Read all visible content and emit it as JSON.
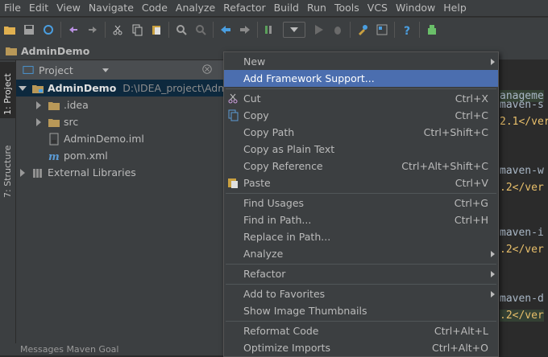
{
  "menubar": [
    "File",
    "Edit",
    "View",
    "Navigate",
    "Code",
    "Analyze",
    "Refactor",
    "Build",
    "Run",
    "Tools",
    "VCS",
    "Window",
    "Help"
  ],
  "navbar": {
    "project": "AdminDemo"
  },
  "side_tabs": {
    "project": "1: Project",
    "structure": "7: Structure"
  },
  "project_panel": {
    "selector": "Project",
    "tree": [
      {
        "label": "AdminDemo",
        "path": "D:\\IDEA_project\\Admin",
        "icon": "module-folder-icon",
        "expanded": true,
        "level": 0,
        "selected": true
      },
      {
        "label": ".idea",
        "icon": "folder-icon",
        "expanded": false,
        "level": 1
      },
      {
        "label": "src",
        "icon": "folder-icon",
        "expanded": false,
        "level": 1
      },
      {
        "label": "AdminDemo.iml",
        "icon": "iml-file-icon",
        "level": 1
      },
      {
        "label": "pom.xml",
        "icon": "maven-file-icon",
        "level": 1
      },
      {
        "label": "External Libraries",
        "icon": "libraries-icon",
        "expanded": false,
        "level": 0
      }
    ]
  },
  "editor_lines": [
    {
      "text": "anageme"
    },
    {
      "text": "maven-s"
    },
    {
      "text": "2.1</ver"
    },
    {
      "text": "maven-w"
    },
    {
      "text": ".2</ver"
    },
    {
      "text": "maven-i"
    },
    {
      "text": ".2</ver"
    },
    {
      "text": "maven-d"
    },
    {
      "text": ".2</ver"
    }
  ],
  "bottom_bar": "Messages Maven Goal",
  "context_menu": [
    {
      "label": "New",
      "submenu": true
    },
    {
      "label": "Add Framework Support...",
      "highlighted": true
    },
    {
      "separator": true
    },
    {
      "label": "Cut",
      "shortcut": "Ctrl+X",
      "icon": "scissors-icon"
    },
    {
      "label": "Copy",
      "shortcut": "Ctrl+C",
      "icon": "copy-icon"
    },
    {
      "label": "Copy Path",
      "shortcut": "Ctrl+Shift+C"
    },
    {
      "label": "Copy as Plain Text"
    },
    {
      "label": "Copy Reference",
      "shortcut": "Ctrl+Alt+Shift+C"
    },
    {
      "label": "Paste",
      "shortcut": "Ctrl+V",
      "icon": "paste-icon"
    },
    {
      "separator": true
    },
    {
      "label": "Find Usages",
      "shortcut": "Ctrl+G"
    },
    {
      "label": "Find in Path...",
      "shortcut": "Ctrl+H"
    },
    {
      "label": "Replace in Path..."
    },
    {
      "label": "Analyze",
      "submenu": true
    },
    {
      "separator": true
    },
    {
      "label": "Refactor",
      "submenu": true
    },
    {
      "separator": true
    },
    {
      "label": "Add to Favorites",
      "submenu": true
    },
    {
      "label": "Show Image Thumbnails"
    },
    {
      "separator": true
    },
    {
      "label": "Reformat Code",
      "shortcut": "Ctrl+Alt+L"
    },
    {
      "label": "Optimize Imports",
      "shortcut": "Ctrl+Alt+O"
    }
  ],
  "colors": {
    "menu_highlight": "#4b6eaf",
    "tree_selection": "#0d293e",
    "panel_bg": "#3c3f41",
    "editor_bg": "#2b2b2b"
  }
}
